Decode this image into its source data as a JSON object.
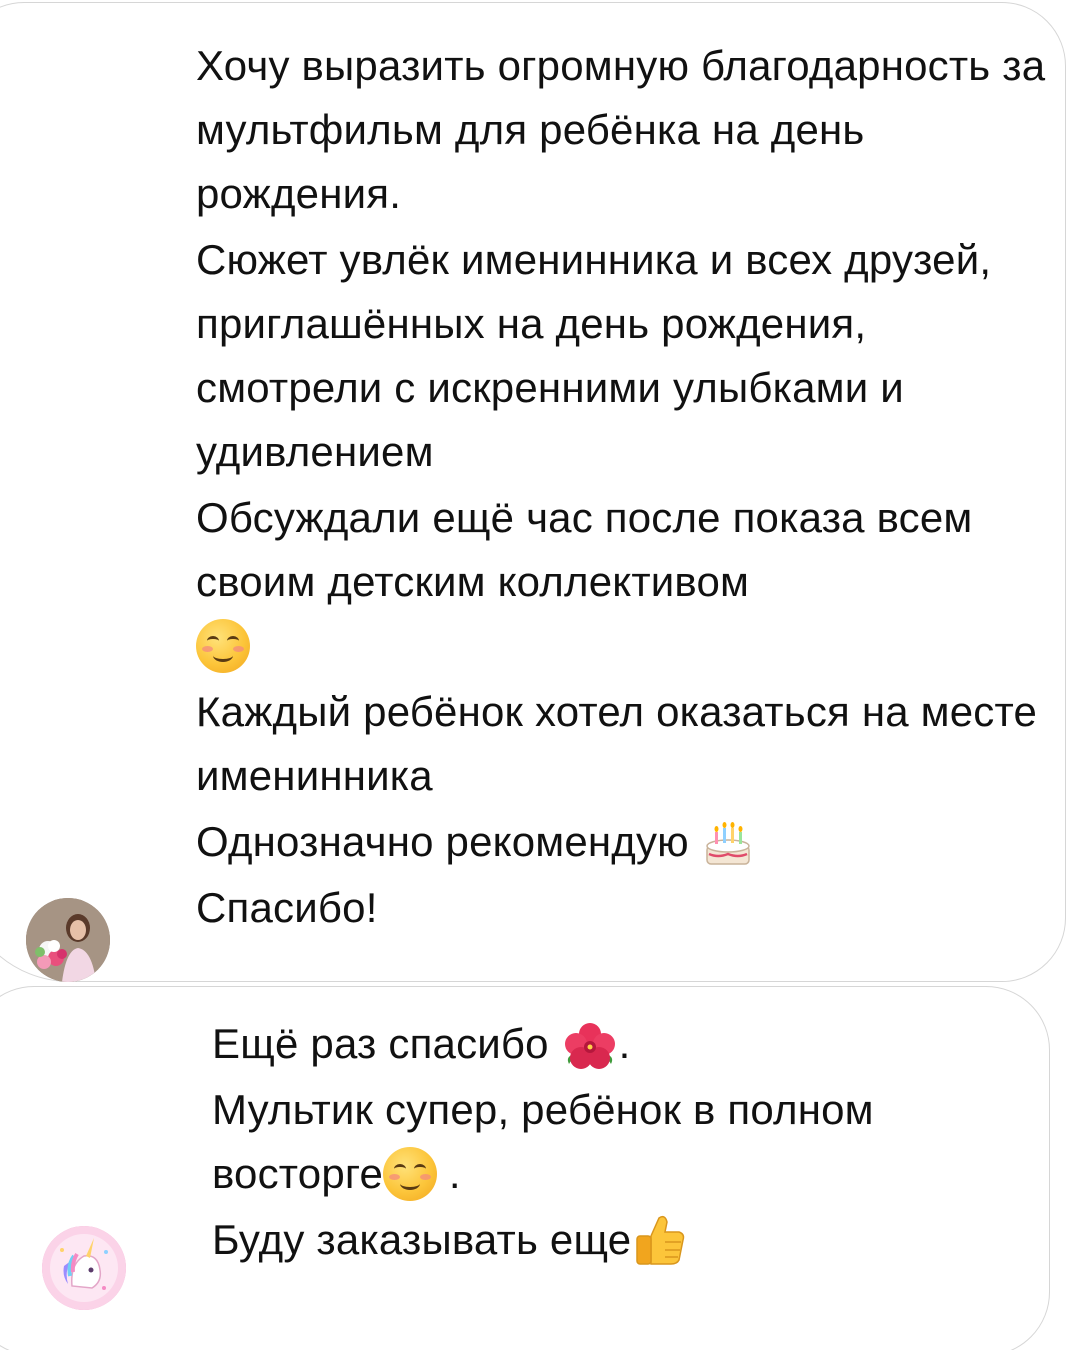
{
  "messages": [
    {
      "avatar_icon": "user-photo-flowers",
      "paragraphs": [
        {
          "text": "Хочу выразить огромную благодарность за мультфильм для ребёнка на день рождения."
        },
        {
          "text": "Сюжет увлёк именинника и всех друзей, приглашённых на день рождения, смотрели с искренними улыбками и удивлением"
        },
        {
          "text": "Обсуждали ещё час после показа всем своим детским коллективом"
        },
        {
          "text": "Каждый ребёнок хотел оказаться на месте именинника"
        },
        {
          "text": "Однозначно рекомендую"
        },
        {
          "text": "Спасибо!"
        }
      ],
      "emojis": [
        "smiling-face-icon",
        "birthday-cake-icon"
      ]
    },
    {
      "avatar_icon": "unicorn-avatar",
      "paragraphs": [
        {
          "text": "Ещё раз спасибо",
          "suffix": "."
        },
        {
          "text": "Мультик супер, ребёнок в полном восторге",
          "suffix": "."
        },
        {
          "text": "Буду заказывать еще"
        }
      ],
      "emojis": [
        "hibiscus-icon",
        "smiling-face-icon",
        "thumbs-up-icon"
      ]
    }
  ],
  "colors": {
    "bubble_border": "#d6d6d6",
    "text": "#111111",
    "emoji_yellow": "#fcc53a",
    "hibiscus": "#e8325a"
  }
}
